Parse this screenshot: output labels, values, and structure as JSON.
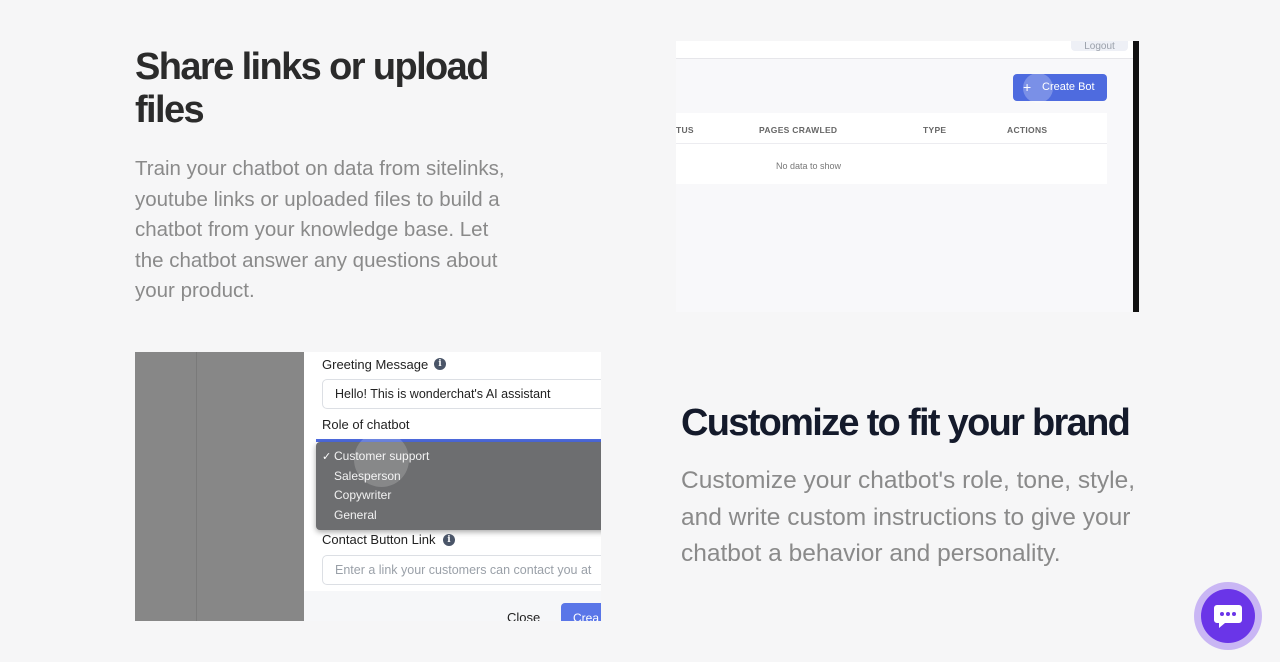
{
  "section1": {
    "title": "Share links or upload files",
    "description": "Train your chatbot on data from sitelinks, youtube links or uploaded files to build a chatbot from your knowledge base. Let the chatbot answer any questions about your product."
  },
  "dashboard_preview": {
    "logout_label": "Logout",
    "create_bot_label": "Create Bot",
    "columns": [
      "TUS",
      "PAGES CRAWLED",
      "TYPE",
      "ACTIONS"
    ],
    "empty_text": "No data to show"
  },
  "settings_preview": {
    "greeting_label": "Greeting Message",
    "greeting_value": "Hello! This is wonderchat's AI assistant",
    "role_label": "Role of chatbot",
    "role_options": [
      "Customer support",
      "Salesperson",
      "Copywriter",
      "General"
    ],
    "role_selected": "Customer support",
    "contact_label": "Contact Button Link",
    "contact_placeholder": "Enter a link your customers can contact you at",
    "close_label": "Close",
    "create_label": "Crea"
  },
  "section2": {
    "title": "Customize to fit your brand",
    "description": "Customize your chatbot's role, tone, style, and write custom instructions to give your chatbot a behavior and personality."
  },
  "chat_widget": {
    "icon": "chat-bubble-icon",
    "color": "#6a35e8"
  }
}
